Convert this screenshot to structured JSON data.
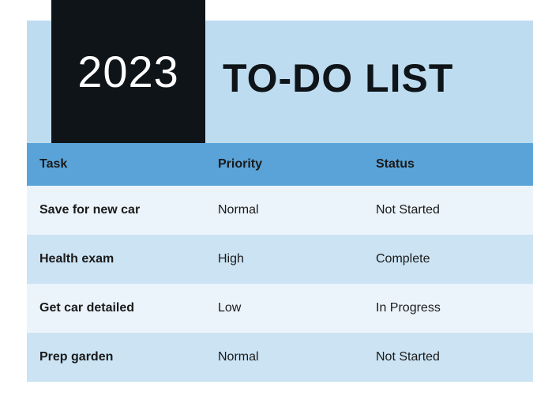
{
  "header": {
    "year": "2023",
    "title": "TO-DO LIST"
  },
  "columns": {
    "task": "Task",
    "priority": "Priority",
    "status": "Status"
  },
  "rows": [
    {
      "task": "Save for new car",
      "priority": "Normal",
      "status": "Not Started"
    },
    {
      "task": "Health exam",
      "priority": "High",
      "status": "Complete"
    },
    {
      "task": "Get car detailed",
      "priority": "Low",
      "status": "In Progress"
    },
    {
      "task": "Prep garden",
      "priority": "Normal",
      "status": "Not Started"
    }
  ]
}
